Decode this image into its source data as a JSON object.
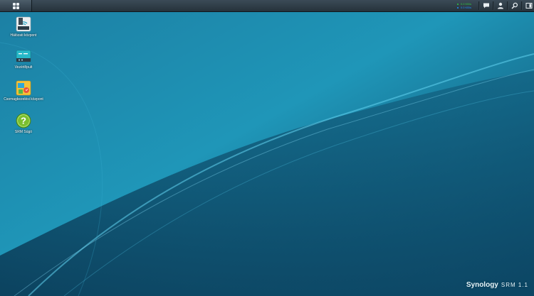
{
  "taskbar": {
    "speed": {
      "upload": "0.0 KB/s",
      "download": "0.0 KB/s",
      "upload_color": "#2ecc40",
      "download_color": "#1e90ff"
    },
    "tray_icons": [
      "notification-icon",
      "user-icon",
      "search-icon",
      "widgets-icon"
    ]
  },
  "desktop": {
    "icons": [
      {
        "label": "Hálózati központ",
        "icon": "network-center-icon"
      },
      {
        "label": "Vezérlőpult",
        "icon": "control-panel-icon"
      },
      {
        "label": "Csomagkezelési központ",
        "icon": "package-center-icon"
      },
      {
        "label": "SRM Súgó",
        "icon": "help-icon"
      }
    ]
  },
  "branding": {
    "name": "Synology",
    "product": "SRM 1.1"
  },
  "colors": {
    "taskbar": "#2f3d48",
    "wallpaper": "#1b87a8",
    "help_green": "#7bbf2e"
  }
}
